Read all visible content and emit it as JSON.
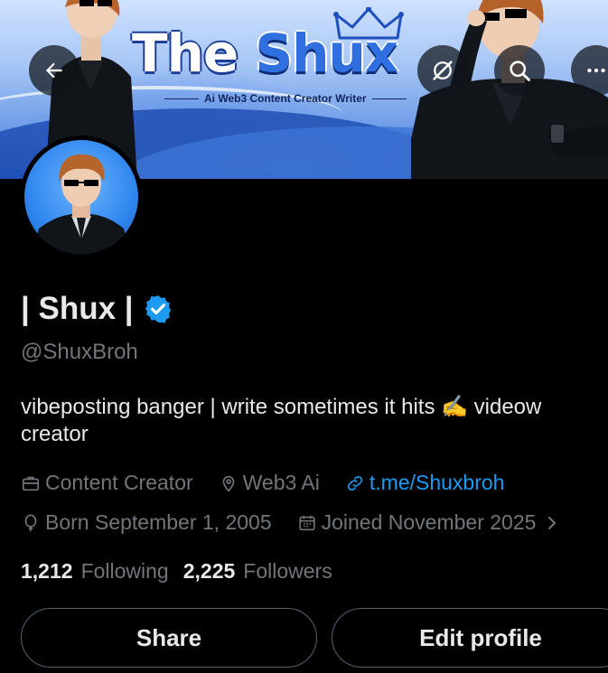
{
  "banner": {
    "title_part1": "The",
    "title_part2": "Shux",
    "subtitle": "Ai Web3 Content Creator Writer"
  },
  "header_icons": [
    "back-arrow-icon",
    "grok-icon",
    "search-icon",
    "more-icon"
  ],
  "profile": {
    "display_name": "| Shux |",
    "handle": "@ShuxBroh",
    "bio_line1": "vibeposting banger | write sometimes it hits ✍️ videow",
    "bio_line2": "creator",
    "category": "Content Creator",
    "location": "Web3 Ai",
    "link": "t.me/Shuxbroh",
    "birthday": "Born September 1, 2005",
    "joined": "Joined November 2025",
    "following_count": "1,212",
    "following_label": "Following",
    "followers_count": "2,225",
    "followers_label": "Followers"
  },
  "actions": {
    "share_label": "Share",
    "edit_label": "Edit profile"
  },
  "colors": {
    "background": "#000000",
    "text_primary": "#e7e9ea",
    "text_secondary": "#71767b",
    "link": "#1d9bf0",
    "border": "#536471"
  }
}
